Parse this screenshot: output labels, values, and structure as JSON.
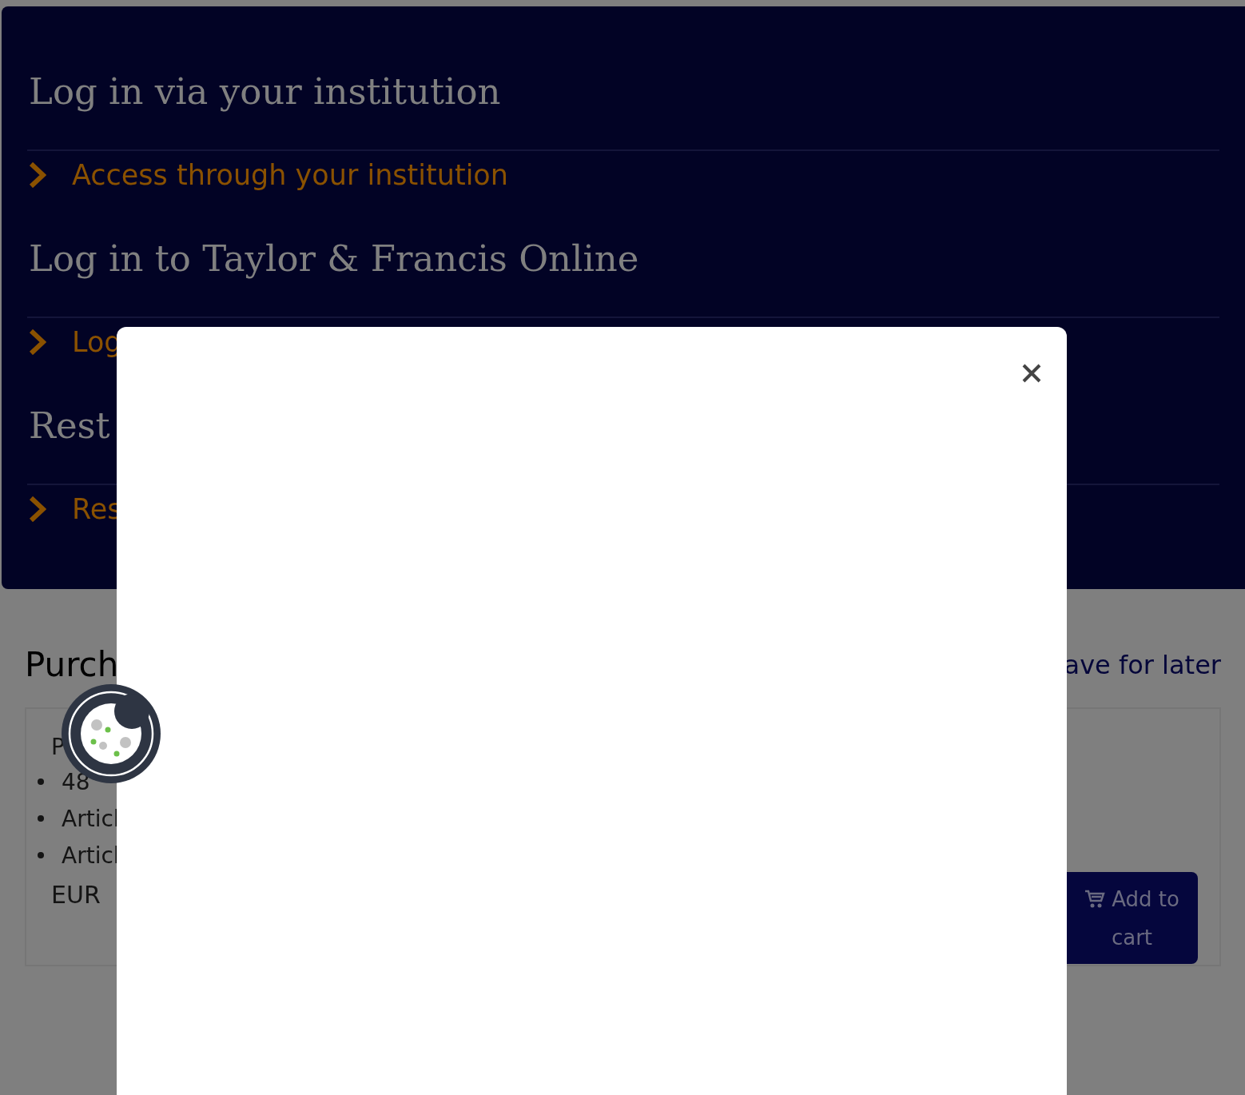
{
  "login_panel": {
    "sections": [
      {
        "heading": "Log in via your institution",
        "link": "Access through your institution"
      },
      {
        "heading": "Log in to Taylor & Francis Online",
        "link": "Log"
      },
      {
        "heading": "Rest",
        "link": "Res"
      }
    ]
  },
  "purchase": {
    "title": "Purch",
    "save_link": "ave for later",
    "option": {
      "title": "P",
      "features": [
        "48",
        "Articl",
        "Articl"
      ],
      "price": "EUR",
      "button": "Add to cart"
    }
  },
  "modal": {
    "kind": "dialog"
  }
}
